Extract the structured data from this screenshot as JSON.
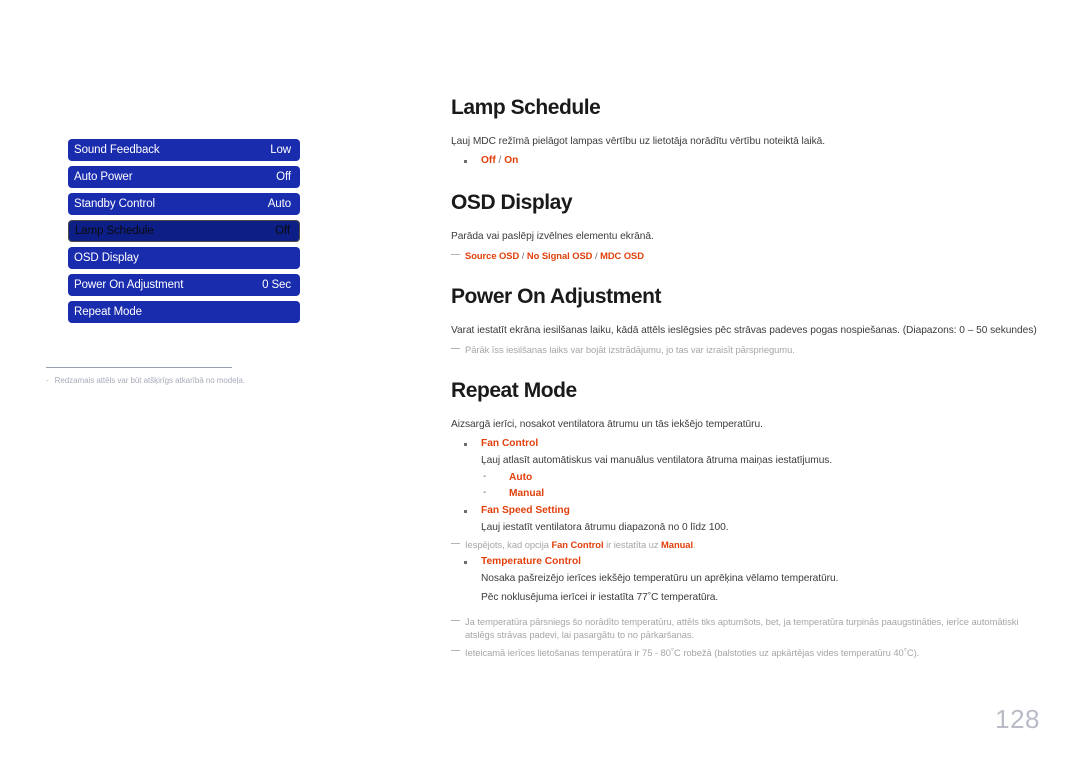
{
  "page": {
    "number": "128",
    "language": "lv"
  },
  "osd_menu": {
    "rows": [
      {
        "label": "Sound Feedback",
        "value": "Low",
        "selected": false
      },
      {
        "label": "Auto Power",
        "value": "Off",
        "selected": false
      },
      {
        "label": "Standby Control",
        "value": "Auto",
        "selected": false
      },
      {
        "label": "Lamp Schedule",
        "value": "Off",
        "selected": true
      },
      {
        "label": "OSD Display",
        "value": "",
        "selected": false
      },
      {
        "label": "Power On Adjustment",
        "value": "0 Sec",
        "selected": false
      },
      {
        "label": "Repeat Mode",
        "value": "",
        "selected": false
      }
    ],
    "footnote": {
      "dash": "-",
      "text": "Redzamais attēls var būt atšķirīgs atkarībā no modeļa."
    },
    "colors": {
      "row_background": "#1a2cae",
      "row_selected_background": "#0d1f86",
      "row_selected_border": "#4e4b46",
      "row_text": "#ffffff",
      "row_selected_text": "#0b0b0b"
    }
  },
  "content": {
    "accent_color": "#e1400c",
    "sections": {
      "lamp_schedule": {
        "title": "Lamp Schedule",
        "desc": "Ļauj MDC režīmā pielāgot lampas vērtību uz lietotāja norādītu vērtību noteiktā laikā.",
        "option_off": "Off",
        "option_sep": " / ",
        "option_on": "On"
      },
      "osd_display": {
        "title": "OSD Display",
        "desc": "Parāda vai paslēpj izvēlnes elementu ekrānā.",
        "opt1": "Source OSD",
        "sep1": " / ",
        "opt2": "No Signal OSD",
        "sep2": " / ",
        "opt3": "MDC OSD"
      },
      "power_on_adjustment": {
        "title": "Power On Adjustment",
        "desc": "Varat iestatīt ekrāna iesilšanas laiku, kādā attēls ieslēgsies pēc strāvas padeves pogas nospiešanas. (Diapazons: 0 – 50 sekundes)",
        "note": "Pārāk īss iesilšanas laiks var bojāt izstrādājumu, jo tas var izraisīt pārspriegumu."
      },
      "repeat_mode": {
        "title": "Repeat Mode",
        "desc": "Aizsargā ierīci, nosakot ventilatora ātrumu un tās iekšējo temperatūru.",
        "fan_control": {
          "label": "Fan Control",
          "desc": "Ļauj atlasīt automātiskus vai manuālus ventilatora ātruma maiņas iestatījumus.",
          "options": [
            "Auto",
            "Manual"
          ]
        },
        "fan_speed_setting": {
          "label": "Fan Speed Setting",
          "desc": "Ļauj iestatīt ventilatora ātrumu diapazonā no 0 līdz 100."
        },
        "note_enabled": {
          "pre": "Iespējots, kad opcija ",
          "term1": "Fan Control",
          "mid": " ir iestatīta uz ",
          "term2": "Manual",
          "post": "."
        },
        "temperature_control": {
          "label": "Temperature Control",
          "desc1": "Nosaka pašreizējo ierīces iekšējo temperatūru un aprēķina vēlamo temperatūru.",
          "desc2_pre": "Pēc noklusējuma ierīcei ir iestatīta 77",
          "desc2_deg": "°",
          "desc2_post": "C temperatūra."
        },
        "note_overheat": "Ja temperatūra pārsniegs šo norādīto temperatūru, attēls tiks aptumšots, bet, ja temperatūra turpinās paaugstināties, ierīce automātiski atslēgs strāvas padevi, lai pasargātu to no pārkaršanas.",
        "note_recommended_pre": "Ieteicamā ierīces lietošanas temperatūra ir 75 - 80",
        "note_recommended_deg1": "°",
        "note_recommended_mid": "C robežā (balstoties uz apkārtējas vides temperatūru 40",
        "note_recommended_deg2": "°",
        "note_recommended_post": "C)."
      }
    }
  }
}
